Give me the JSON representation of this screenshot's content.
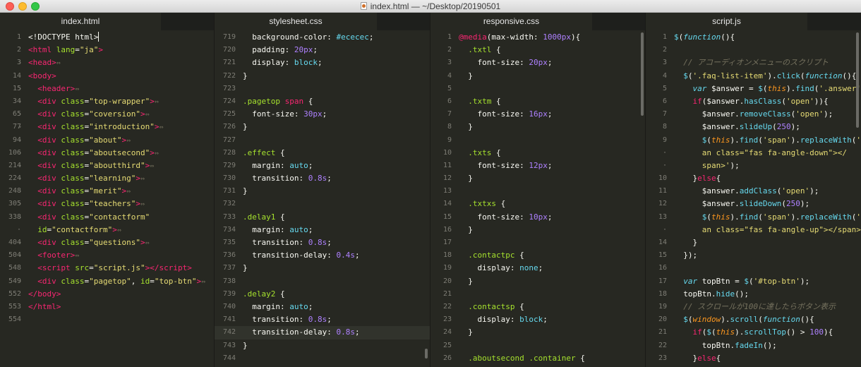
{
  "window": {
    "title": "index.html — ~/Desktop/20190501"
  },
  "panes": [
    {
      "tab": "index.html",
      "lines": [
        {
          "n": "1",
          "fold": "",
          "html": "<span class='tok-punc'>&lt;!DOCTYPE html&gt;</span><span class='cursor'></span>"
        },
        {
          "n": "2",
          "fold": "",
          "html": "<span class='tok-tag'>&lt;html</span> <span class='tok-attr'>lang</span>=<span class='tok-str'>\"ja\"</span><span class='tok-tag'>&gt;</span>"
        },
        {
          "n": "3",
          "fold": "›",
          "html": "<span class='tok-tag'>&lt;head&gt;</span><span class='fold-marker'>⇔</span>"
        },
        {
          "n": "14",
          "fold": "",
          "html": "<span class='tok-tag'>&lt;body&gt;</span>"
        },
        {
          "n": "15",
          "fold": "›",
          "html": "  <span class='tok-tag'>&lt;header&gt;</span><span class='fold-marker'>⇔</span>"
        },
        {
          "n": "34",
          "fold": "›",
          "html": "  <span class='tok-tag'>&lt;div</span> <span class='tok-attr'>class</span>=<span class='tok-str'>\"top-wrapper\"</span><span class='tok-tag'>&gt;</span><span class='fold-marker'>⇔</span>"
        },
        {
          "n": "65",
          "fold": "›",
          "html": "  <span class='tok-tag'>&lt;div</span> <span class='tok-attr'>class</span>=<span class='tok-str'>\"coversion\"</span><span class='tok-tag'>&gt;</span><span class='fold-marker'>⇔</span>"
        },
        {
          "n": "77",
          "fold": "›",
          "html": "  <span class='tok-tag'>&lt;div</span> <span class='tok-attr'>class</span>=<span class='tok-str'>\"introduction\"</span><span class='tok-tag'>&gt;</span><span class='fold-marker'>⇔</span>"
        },
        {
          "n": "94",
          "fold": "›",
          "html": "  <span class='tok-tag'>&lt;div</span> <span class='tok-attr'>class</span>=<span class='tok-str'>\"about\"</span><span class='tok-tag'>&gt;</span><span class='fold-marker'>⇔</span>"
        },
        {
          "n": "106",
          "fold": "›",
          "html": "  <span class='tok-tag'>&lt;div</span> <span class='tok-attr'>class</span>=<span class='tok-str'>\"aboutsecond\"</span><span class='tok-tag'>&gt;</span><span class='fold-marker'>⇔</span>"
        },
        {
          "n": "214",
          "fold": "›",
          "html": "  <span class='tok-tag'>&lt;div</span> <span class='tok-attr'>class</span>=<span class='tok-str'>\"aboutthird\"</span><span class='tok-tag'>&gt;</span><span class='fold-marker'>⇔</span>"
        },
        {
          "n": "224",
          "fold": "›",
          "html": "  <span class='tok-tag'>&lt;div</span> <span class='tok-attr'>class</span>=<span class='tok-str'>\"learning\"</span><span class='tok-tag'>&gt;</span><span class='fold-marker'>⇔</span>"
        },
        {
          "n": "248",
          "fold": "›",
          "html": "  <span class='tok-tag'>&lt;div</span> <span class='tok-attr'>class</span>=<span class='tok-str'>\"merit\"</span><span class='tok-tag'>&gt;</span><span class='fold-marker'>⇔</span>"
        },
        {
          "n": "305",
          "fold": "›",
          "html": "  <span class='tok-tag'>&lt;div</span> <span class='tok-attr'>class</span>=<span class='tok-str'>\"teachers\"</span><span class='tok-tag'>&gt;</span><span class='fold-marker'>⇔</span>"
        },
        {
          "n": "338",
          "fold": "›",
          "html": "  <span class='tok-tag'>&lt;div</span> <span class='tok-attr'>class</span>=<span class='tok-str'>\"contactform\"</span>"
        },
        {
          "n": "·",
          "fold": "",
          "html": "  <span class='tok-attr'>id</span>=<span class='tok-str'>\"contactform\"</span><span class='tok-tag'>&gt;</span><span class='fold-marker'>⇔</span>"
        },
        {
          "n": "404",
          "fold": "›",
          "html": "  <span class='tok-tag'>&lt;div</span> <span class='tok-attr'>class</span>=<span class='tok-str'>\"questions\"</span><span class='tok-tag'>&gt;</span><span class='fold-marker'>⇔</span>"
        },
        {
          "n": "504",
          "fold": "›",
          "html": "  <span class='tok-tag'>&lt;footer&gt;</span><span class='fold-marker'>⇔</span>"
        },
        {
          "n": "548",
          "fold": "",
          "html": "  <span class='tok-tag'>&lt;script</span> <span class='tok-attr'>src</span>=<span class='tok-str'>\"script.js\"</span><span class='tok-tag'>&gt;&lt;/script&gt;</span>"
        },
        {
          "n": "549",
          "fold": "›",
          "html": "  <span class='tok-tag'>&lt;div</span> <span class='tok-attr'>class</span>=<span class='tok-str'>\"pagetop\"</span>, <span class='tok-attr'>id</span>=<span class='tok-str'>\"top-btn\"</span><span class='tok-tag'>&gt;</span><span class='fold-marker'>⇔</span>"
        },
        {
          "n": "552",
          "fold": "",
          "html": "<span class='tok-tag'>&lt;/body&gt;</span>"
        },
        {
          "n": "553",
          "fold": "",
          "html": "<span class='tok-tag'>&lt;/html&gt;</span>"
        },
        {
          "n": "554",
          "fold": "",
          "html": ""
        }
      ]
    },
    {
      "tab": "stylesheet.css",
      "lines": [
        {
          "n": "719",
          "fold": "",
          "html": "  <span class='tok-prop'>background-color</span>: <span class='tok-val'>#ececec</span>;"
        },
        {
          "n": "720",
          "fold": "",
          "html": "  <span class='tok-prop'>padding</span>: <span class='tok-num'>20px</span>;"
        },
        {
          "n": "721",
          "fold": "",
          "html": "  <span class='tok-prop'>display</span>: <span class='tok-val'>block</span>;"
        },
        {
          "n": "722",
          "fold": "",
          "html": "}"
        },
        {
          "n": "723",
          "fold": "",
          "html": ""
        },
        {
          "n": "724",
          "fold": "",
          "html": "<span class='tok-sel'>.pagetop</span> <span class='tok-tag'>span</span> {"
        },
        {
          "n": "725",
          "fold": "",
          "html": "  <span class='tok-prop'>font-size</span>: <span class='tok-num'>30px</span>;"
        },
        {
          "n": "726",
          "fold": "",
          "html": "}"
        },
        {
          "n": "727",
          "fold": "",
          "html": ""
        },
        {
          "n": "728",
          "fold": "",
          "html": "<span class='tok-sel'>.effect</span> {"
        },
        {
          "n": "729",
          "fold": "",
          "html": "  <span class='tok-prop'>margin</span>: <span class='tok-val'>auto</span>;"
        },
        {
          "n": "730",
          "fold": "",
          "html": "  <span class='tok-prop'>transition</span>: <span class='tok-num'>0.8s</span>;"
        },
        {
          "n": "731",
          "fold": "",
          "html": "}"
        },
        {
          "n": "732",
          "fold": "",
          "html": ""
        },
        {
          "n": "733",
          "fold": "",
          "html": "<span class='tok-sel'>.delay1</span> {"
        },
        {
          "n": "734",
          "fold": "",
          "html": "  <span class='tok-prop'>margin</span>: <span class='tok-val'>auto</span>;"
        },
        {
          "n": "735",
          "fold": "",
          "html": "  <span class='tok-prop'>transition</span>: <span class='tok-num'>0.8s</span>;"
        },
        {
          "n": "736",
          "fold": "",
          "html": "  <span class='tok-prop'>transition-delay</span>: <span class='tok-num'>0.4s</span>;"
        },
        {
          "n": "737",
          "fold": "",
          "html": "}"
        },
        {
          "n": "738",
          "fold": "",
          "html": ""
        },
        {
          "n": "739",
          "fold": "",
          "html": "<span class='tok-sel'>.delay2</span> {"
        },
        {
          "n": "740",
          "fold": "",
          "html": "  <span class='tok-prop'>margin</span>: <span class='tok-val'>auto</span>;"
        },
        {
          "n": "741",
          "fold": "",
          "html": "  <span class='tok-prop'>transition</span>: <span class='tok-num'>0.8s</span>;"
        },
        {
          "n": "742",
          "fold": "",
          "hl": true,
          "html": "  <span class='tok-prop'>transition-delay</span>: <span class='tok-num'>0.8s</span>;"
        },
        {
          "n": "743",
          "fold": "",
          "html": "}"
        },
        {
          "n": "744",
          "fold": "",
          "html": ""
        }
      ]
    },
    {
      "tab": "responsive.css",
      "lines": [
        {
          "n": "1",
          "fold": "",
          "html": "<span class='tok-at'>@media</span>(<span class='tok-prop'>max-width</span>: <span class='tok-num'>1000px</span>){"
        },
        {
          "n": "2",
          "fold": "",
          "html": "  <span class='tok-sel'>.txtl</span> {"
        },
        {
          "n": "3",
          "fold": "",
          "html": "    <span class='tok-prop'>font-size</span>: <span class='tok-num'>20px</span>;"
        },
        {
          "n": "4",
          "fold": "",
          "html": "  }"
        },
        {
          "n": "5",
          "fold": "",
          "html": ""
        },
        {
          "n": "6",
          "fold": "",
          "html": "  <span class='tok-sel'>.txtm</span> {"
        },
        {
          "n": "7",
          "fold": "",
          "html": "    <span class='tok-prop'>font-size</span>: <span class='tok-num'>16px</span>;"
        },
        {
          "n": "8",
          "fold": "",
          "html": "  }"
        },
        {
          "n": "9",
          "fold": "",
          "html": ""
        },
        {
          "n": "10",
          "fold": "",
          "html": "  <span class='tok-sel'>.txts</span> {"
        },
        {
          "n": "11",
          "fold": "",
          "html": "    <span class='tok-prop'>font-size</span>: <span class='tok-num'>12px</span>;"
        },
        {
          "n": "12",
          "fold": "",
          "html": "  }"
        },
        {
          "n": "13",
          "fold": "",
          "html": ""
        },
        {
          "n": "14",
          "fold": "",
          "html": "  <span class='tok-sel'>.txtxs</span> {"
        },
        {
          "n": "15",
          "fold": "",
          "html": "    <span class='tok-prop'>font-size</span>: <span class='tok-num'>10px</span>;"
        },
        {
          "n": "16",
          "fold": "",
          "html": "  }"
        },
        {
          "n": "17",
          "fold": "",
          "html": ""
        },
        {
          "n": "18",
          "fold": "",
          "html": "  <span class='tok-sel'>.contactpc</span> {"
        },
        {
          "n": "19",
          "fold": "",
          "html": "    <span class='tok-prop'>display</span>: <span class='tok-val'>none</span>;"
        },
        {
          "n": "20",
          "fold": "",
          "html": "  }"
        },
        {
          "n": "21",
          "fold": "",
          "html": ""
        },
        {
          "n": "22",
          "fold": "",
          "html": "  <span class='tok-sel'>.contactsp</span> {"
        },
        {
          "n": "23",
          "fold": "",
          "html": "    <span class='tok-prop'>display</span>: <span class='tok-val'>block</span>;"
        },
        {
          "n": "24",
          "fold": "",
          "html": "  }"
        },
        {
          "n": "25",
          "fold": "",
          "html": ""
        },
        {
          "n": "26",
          "fold": "",
          "html": "  <span class='tok-sel'>.aboutsecond</span> <span class='tok-sel'>.container</span> {"
        }
      ]
    },
    {
      "tab": "script.js",
      "lines": [
        {
          "n": "1",
          "fold": "",
          "html": "<span class='tok-fn'>$</span>(<span class='tok-kw'>function</span>(){"
        },
        {
          "n": "2",
          "fold": "",
          "html": ""
        },
        {
          "n": "3",
          "fold": "",
          "html": "  <span class='tok-com'>// アコーディオンメニューのスクリプト</span>"
        },
        {
          "n": "4",
          "fold": "",
          "html": "  <span class='tok-fn'>$</span>(<span class='tok-str'>'.faq-list-item'</span>).<span class='tok-fn'>click</span>(<span class='tok-kw'>function</span>(){"
        },
        {
          "n": "5",
          "fold": "",
          "html": "    <span class='tok-kw'>var</span> $answer = <span class='tok-fn'>$</span>(<span class='tok-var'>this</span>).<span class='tok-fn'>find</span>(<span class='tok-str'>'.answer'</span>);"
        },
        {
          "n": "6",
          "fold": "",
          "html": "    <span class='tok-ctl'>if</span>($answer.<span class='tok-fn'>hasClass</span>(<span class='tok-str'>'open'</span>)){"
        },
        {
          "n": "7",
          "fold": "",
          "html": "      $answer.<span class='tok-fn'>removeClass</span>(<span class='tok-str'>'open'</span>);"
        },
        {
          "n": "8",
          "fold": "",
          "html": "      $answer.<span class='tok-fn'>slideUp</span>(<span class='tok-num'>250</span>);"
        },
        {
          "n": "9",
          "fold": "",
          "html": "      <span class='tok-fn'>$</span>(<span class='tok-var'>this</span>).<span class='tok-fn'>find</span>(<span class='tok-str'>'span'</span>).<span class='tok-fn'>replaceWith</span>(<span class='tok-str'>'&lt;sp</span>"
        },
        {
          "n": "·",
          "fold": "",
          "html": "      <span class='tok-str'>an class=\"fas fa-angle-down\"&gt;&lt;/</span>"
        },
        {
          "n": "·",
          "fold": "",
          "html": "      <span class='tok-str'>span&gt;'</span>);"
        },
        {
          "n": "10",
          "fold": "",
          "html": "    }<span class='tok-ctl'>else</span>{"
        },
        {
          "n": "11",
          "fold": "",
          "html": "      $answer.<span class='tok-fn'>addClass</span>(<span class='tok-str'>'open'</span>);"
        },
        {
          "n": "12",
          "fold": "",
          "html": "      $answer.<span class='tok-fn'>slideDown</span>(<span class='tok-num'>250</span>);"
        },
        {
          "n": "13",
          "fold": "",
          "html": "      <span class='tok-fn'>$</span>(<span class='tok-var'>this</span>).<span class='tok-fn'>find</span>(<span class='tok-str'>'span'</span>).<span class='tok-fn'>replaceWith</span>(<span class='tok-str'>'&lt;sp</span>"
        },
        {
          "n": "·",
          "fold": "",
          "html": "      <span class='tok-str'>an class=\"fas fa-angle-up\"&gt;&lt;/span&gt;'</span>);"
        },
        {
          "n": "14",
          "fold": "",
          "html": "    }"
        },
        {
          "n": "15",
          "fold": "",
          "html": "  });"
        },
        {
          "n": "16",
          "fold": "",
          "html": ""
        },
        {
          "n": "17",
          "fold": "",
          "html": "  <span class='tok-kw'>var</span> topBtn = <span class='tok-fn'>$</span>(<span class='tok-str'>'#top-btn'</span>);"
        },
        {
          "n": "18",
          "fold": "",
          "html": "  topBtn.<span class='tok-fn'>hide</span>();"
        },
        {
          "n": "19",
          "fold": "",
          "html": "  <span class='tok-com'>// スクロールが100に達したらボタン表示</span>"
        },
        {
          "n": "20",
          "fold": "",
          "html": "  <span class='tok-fn'>$</span>(<span class='tok-var'>window</span>).<span class='tok-fn'>scroll</span>(<span class='tok-kw'>function</span>(){"
        },
        {
          "n": "21",
          "fold": "",
          "html": "    <span class='tok-ctl'>if</span>(<span class='tok-fn'>$</span>(<span class='tok-var'>this</span>).<span class='tok-fn'>scrollTop</span>() &gt; <span class='tok-num'>100</span>){"
        },
        {
          "n": "22",
          "fold": "",
          "html": "      topBtn.<span class='tok-fn'>fadeIn</span>();"
        },
        {
          "n": "23",
          "fold": "",
          "html": "    }<span class='tok-ctl'>else</span>{"
        }
      ]
    }
  ]
}
